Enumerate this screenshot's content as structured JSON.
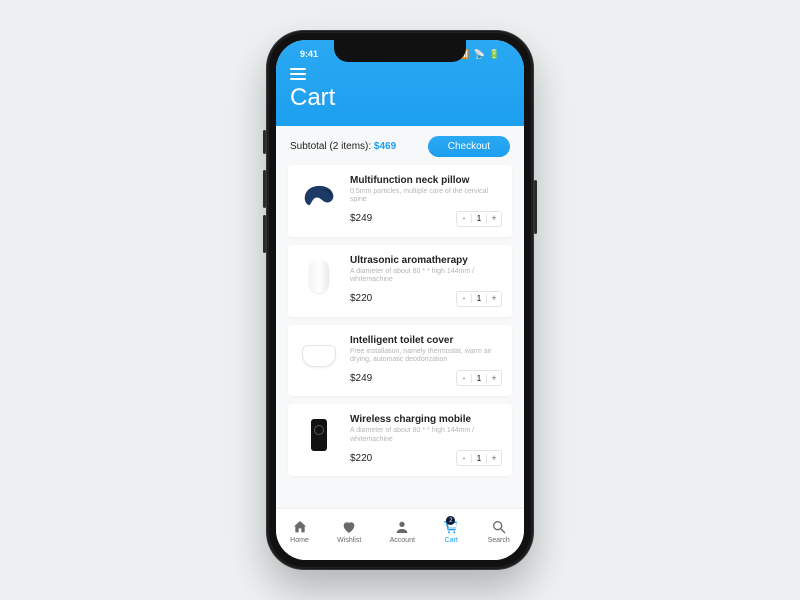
{
  "status": {
    "time": "9:41",
    "signal": "▪▪▪▮",
    "wifi": "⌃",
    "battery": "▰▰"
  },
  "header": {
    "title": "Cart"
  },
  "subtotal": {
    "label": "Subtotal (2 items): ",
    "amount": "$469",
    "checkout": "Checkout"
  },
  "items": [
    {
      "name": "Multifunction neck pillow",
      "desc": "0.5mm particles, multiple care of the cervical spine",
      "price": "$249",
      "qty": "1"
    },
    {
      "name": "Ultrasonic aromatherapy",
      "desc": "A diameter of about 80 * * high 144mm / whitemachine",
      "price": "$220",
      "qty": "1"
    },
    {
      "name": "Intelligent toilet cover",
      "desc": "Free installation, namely thermostat, warm air drying, automatic deodorization",
      "price": "$249",
      "qty": "1"
    },
    {
      "name": "Wireless charging mobile",
      "desc": "A diameter of about 80 * * high 144mm / whitemachine",
      "price": "$220",
      "qty": "1"
    }
  ],
  "tabs": {
    "home": "Home",
    "wishlist": "Wishlist",
    "account": "Account",
    "cart": "Cart",
    "search": "Search",
    "badge": "2"
  }
}
